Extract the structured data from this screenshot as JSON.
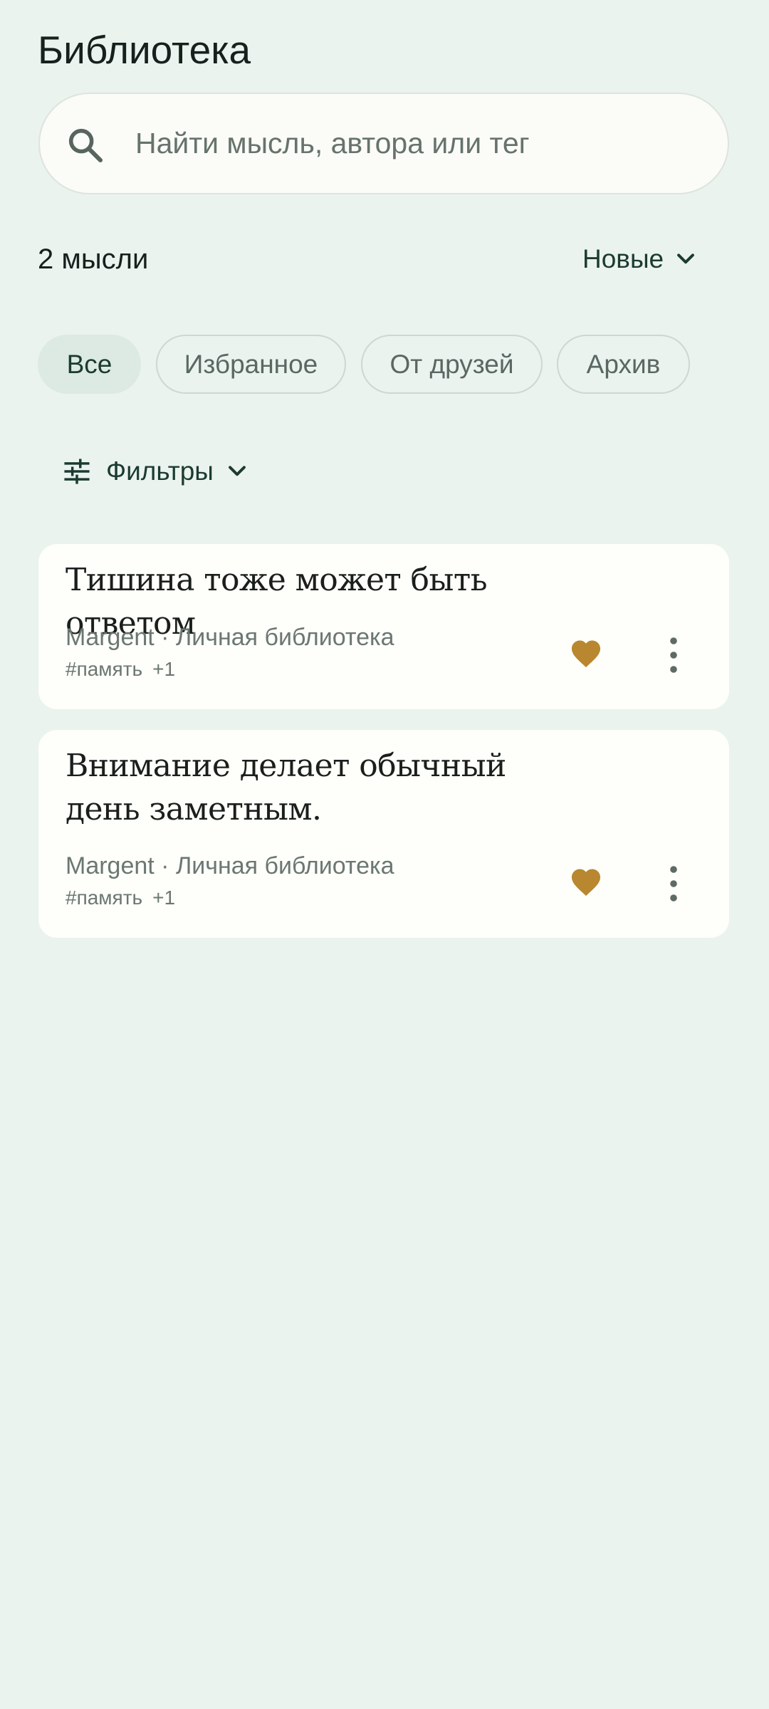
{
  "header": {
    "title": "Библиотека"
  },
  "search": {
    "placeholder": "Найти мысль, автора или тег",
    "value": "",
    "icon": "search-icon"
  },
  "summary": {
    "count_label": "2 мысли",
    "sort_label": "Новые",
    "sort_icon": "chevron-down-icon"
  },
  "tabs": [
    {
      "label": "Все",
      "active": true
    },
    {
      "label": "Избранное",
      "active": false
    },
    {
      "label": "От друзей",
      "active": false
    },
    {
      "label": "Архив",
      "active": false
    }
  ],
  "filters": {
    "label": "Фильтры",
    "icon": "tune-icon",
    "chevron": "chevron-down-icon"
  },
  "thoughts": [
    {
      "text": "Тишина тоже может быть ответом",
      "meta": "Margent · Личная библиотека",
      "tag": "#память",
      "more_tags": "+1",
      "favorite": true
    },
    {
      "text": "Внимание делает обычный день заметным.",
      "meta": "Margent · Личная библиотека",
      "tag": "#память",
      "more_tags": "+1",
      "favorite": true
    }
  ],
  "colors": {
    "background": "#EAF3EE",
    "card": "#FEFEFA",
    "accent_dark": "#1C3B30",
    "heart": "#B8872F",
    "chip_active": "#DCEAE3"
  }
}
